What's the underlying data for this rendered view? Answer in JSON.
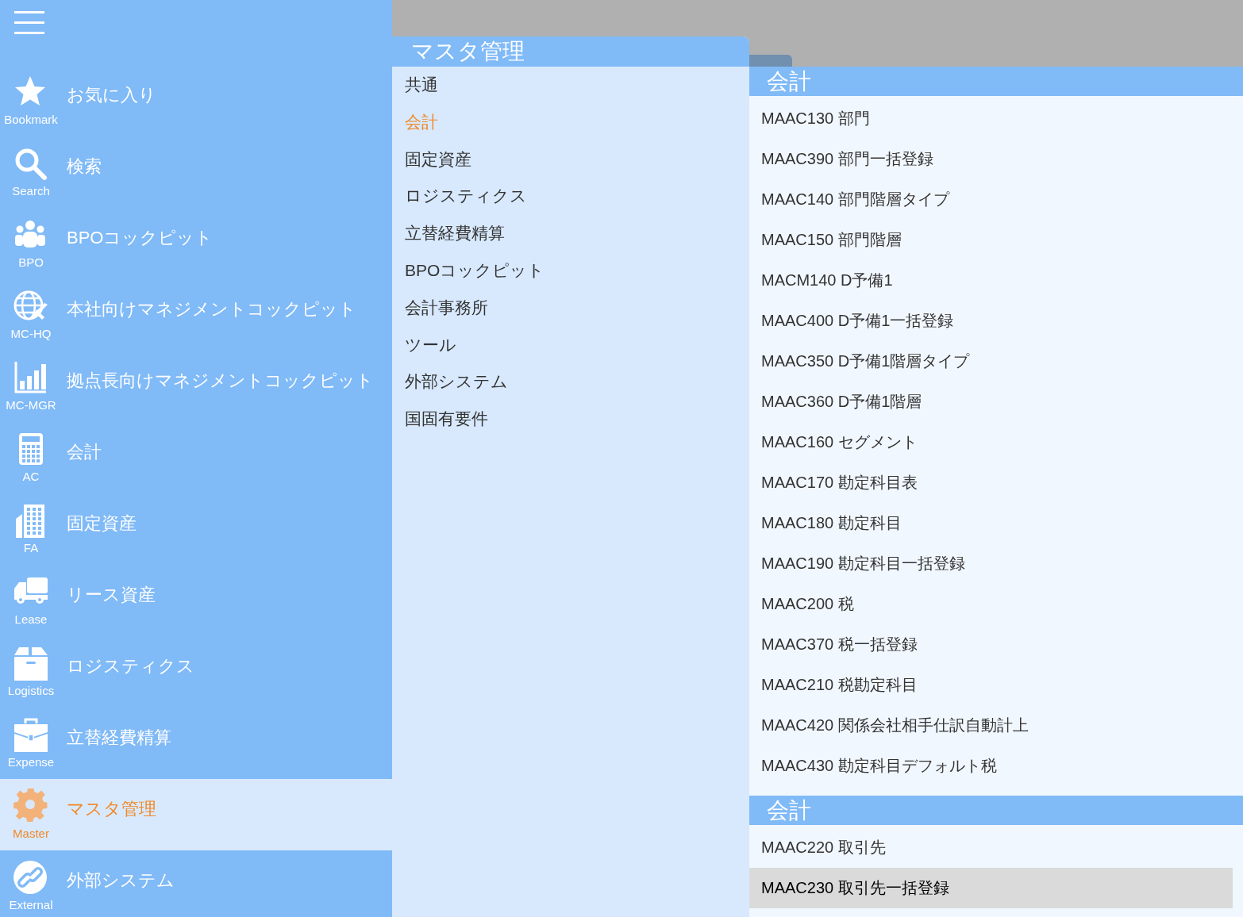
{
  "sidebar": {
    "items": [
      {
        "label": "お気に入り",
        "short_label": "Bookmark",
        "kind": "star",
        "selected": false
      },
      {
        "label": "検索",
        "short_label": "Search",
        "kind": "search",
        "selected": false
      },
      {
        "label": "BPOコックピット",
        "short_label": "BPO",
        "kind": "users",
        "selected": false
      },
      {
        "label": "本社向けマネジメントコックピット",
        "short_label": "MC-HQ",
        "kind": "globe",
        "selected": false
      },
      {
        "label": "拠点長向けマネジメントコックピット",
        "short_label": "MC-MGR",
        "kind": "chart",
        "selected": false
      },
      {
        "label": "会計",
        "short_label": "AC",
        "kind": "calculator",
        "selected": false
      },
      {
        "label": "固定資産",
        "short_label": "FA",
        "kind": "building",
        "selected": false
      },
      {
        "label": "リース資産",
        "short_label": "Lease",
        "kind": "truck",
        "selected": false
      },
      {
        "label": "ロジスティクス",
        "short_label": "Logistics",
        "kind": "box",
        "selected": false
      },
      {
        "label": "立替経費精算",
        "short_label": "Expense",
        "kind": "briefcase",
        "selected": false
      },
      {
        "label": "マスタ管理",
        "short_label": "Master",
        "kind": "gear",
        "selected": true
      },
      {
        "label": "外部システム",
        "short_label": "External",
        "kind": "link",
        "selected": false
      }
    ]
  },
  "menu_panel": {
    "title": "マスタ管理",
    "items": [
      {
        "label": "共通",
        "selected": false
      },
      {
        "label": "会計",
        "selected": true
      },
      {
        "label": "固定資産",
        "selected": false
      },
      {
        "label": "ロジスティクス",
        "selected": false
      },
      {
        "label": "立替経費精算",
        "selected": false
      },
      {
        "label": "BPOコックピット",
        "selected": false
      },
      {
        "label": "会計事務所",
        "selected": false
      },
      {
        "label": "ツール",
        "selected": false
      },
      {
        "label": "外部システム",
        "selected": false
      },
      {
        "label": "国固有要件",
        "selected": false
      }
    ]
  },
  "detail_panel": {
    "sections": [
      {
        "title": "会計",
        "items": [
          {
            "label": "MAAC130 部門",
            "highlighted": false
          },
          {
            "label": "MAAC390 部門一括登録",
            "highlighted": false
          },
          {
            "label": "MAAC140 部門階層タイプ",
            "highlighted": false
          },
          {
            "label": "MAAC150 部門階層",
            "highlighted": false
          },
          {
            "label": "MACM140 D予備1",
            "highlighted": false
          },
          {
            "label": "MAAC400 D予備1一括登録",
            "highlighted": false
          },
          {
            "label": "MAAC350 D予備1階層タイプ",
            "highlighted": false
          },
          {
            "label": "MAAC360 D予備1階層",
            "highlighted": false
          },
          {
            "label": "MAAC160 セグメント",
            "highlighted": false
          },
          {
            "label": "MAAC170 勘定科目表",
            "highlighted": false
          },
          {
            "label": "MAAC180 勘定科目",
            "highlighted": false
          },
          {
            "label": "MAAC190 勘定科目一括登録",
            "highlighted": false
          },
          {
            "label": "MAAC200 税",
            "highlighted": false
          },
          {
            "label": "MAAC370 税一括登録",
            "highlighted": false
          },
          {
            "label": "MAAC210 税勘定科目",
            "highlighted": false
          },
          {
            "label": "MAAC420 関係会社相手仕訳自動計上",
            "highlighted": false
          },
          {
            "label": "MAAC430 勘定科目デフォルト税",
            "highlighted": false
          }
        ]
      },
      {
        "title": "会計",
        "items": [
          {
            "label": "MAAC220 取引先",
            "highlighted": false
          },
          {
            "label": "MAAC230 取引先一括登録",
            "highlighted": true
          }
        ]
      }
    ]
  }
}
